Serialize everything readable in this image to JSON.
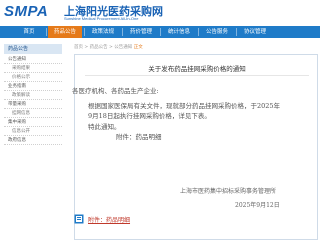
{
  "header": {
    "logo_text": "SMPA",
    "site_title": "上海阳光医药采购网",
    "site_subtitle": "Sunshine Medical Procurement All-In-One"
  },
  "nav": {
    "items": [
      {
        "label": "首页"
      },
      {
        "label": "药品公告"
      },
      {
        "label": "政策法规"
      },
      {
        "label": "药价管理"
      },
      {
        "label": "统计信息"
      },
      {
        "label": "公告服务"
      },
      {
        "label": "协议管理"
      }
    ],
    "active_index": 1
  },
  "sidebar": {
    "heading": "药品公告",
    "items": [
      {
        "label": "公告通知"
      },
      {
        "label": "采购结果"
      },
      {
        "label": "价格公示"
      },
      {
        "label": "业务指南"
      },
      {
        "label": "政策解读"
      },
      {
        "label": "带量采购"
      },
      {
        "label": "挂网信息"
      },
      {
        "label": "集中采购"
      },
      {
        "label": "信息公开"
      },
      {
        "label": "政府信息"
      }
    ]
  },
  "breadcrumb": {
    "text": "首页 > 药品公告 > 公告通知",
    "current": "正文"
  },
  "document": {
    "title": "关于发布药品挂网采购价格的通知",
    "salutation": "各医疗机构、各药品生产企业:",
    "body_line1": "根据国家医保局有关文件，现就部分药品挂网采购价格，于2025年",
    "body_line2": "9月18日起执行挂网采购价格，详见下表。",
    "closing": "特此通知。",
    "attachment_note": "附件：药品明细",
    "signature_org": "上海市医药集中招标采购事务管理所",
    "signature_date": "2025年9月12日"
  },
  "attachment": {
    "link_text": "附件：药品明细",
    "icon": "attachment-icon"
  },
  "colors": {
    "brand_blue": "#1f7bc8",
    "accent_orange": "#e57a1a",
    "link_red": "#c0392b"
  }
}
